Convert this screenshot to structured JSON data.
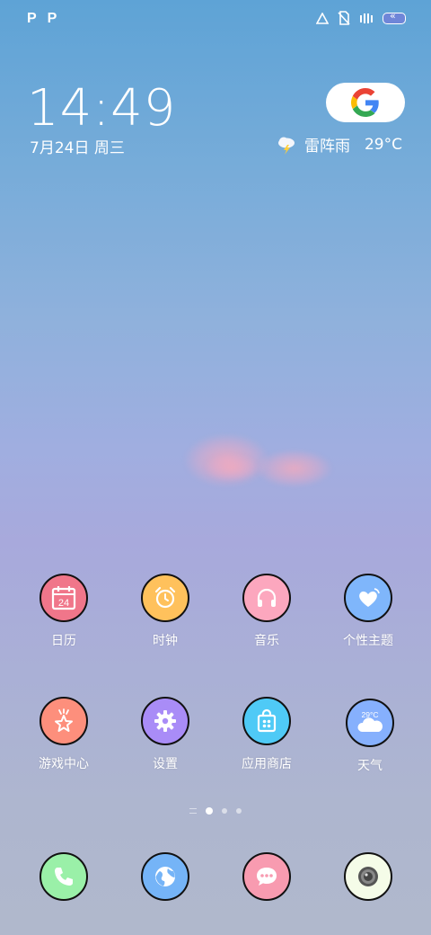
{
  "status_bar": {
    "left_icons": [
      "P",
      "P"
    ],
    "right_icons": [
      "signal-triangle-icon",
      "no-sim-icon",
      "vibrate-icon",
      "battery-icon"
    ]
  },
  "clock": {
    "time": "14:49",
    "date": "7月24日 周三"
  },
  "weather": {
    "condition": "雷阵雨",
    "temperature": "29°C",
    "icon": "thunderstorm-icon"
  },
  "search": {
    "icon": "google-icon"
  },
  "apps_row1": [
    {
      "label": "日历",
      "icon": "calendar-icon",
      "color": "#f0768a",
      "badge": "24"
    },
    {
      "label": "时钟",
      "icon": "alarm-clock-icon",
      "color": "#ffc15c"
    },
    {
      "label": "音乐",
      "icon": "headphones-icon",
      "color": "#fca7be"
    },
    {
      "label": "个性主题",
      "icon": "heart-theme-icon",
      "color": "#7fb6fb"
    }
  ],
  "apps_row2": [
    {
      "label": "游戏中心",
      "icon": "star-game-icon",
      "color": "#fd8f7c"
    },
    {
      "label": "设置",
      "icon": "gear-icon",
      "color": "#a98cf7"
    },
    {
      "label": "应用商店",
      "icon": "shopping-bag-icon",
      "color": "#4fcaf6"
    },
    {
      "label": "天气",
      "icon": "weather-cloud-icon",
      "color": "#86b0fd",
      "badge": "29°C"
    }
  ],
  "dock": [
    {
      "name": "phone",
      "icon": "phone-icon",
      "color": "#9af0a8"
    },
    {
      "name": "browser",
      "icon": "globe-icon",
      "color": "#75b4f7"
    },
    {
      "name": "messages",
      "icon": "message-bubble-icon",
      "color": "#f89bb0"
    },
    {
      "name": "camera",
      "icon": "camera-lens-icon",
      "color": "#f5fce8"
    }
  ],
  "page_indicator": {
    "pages": 4,
    "current": 2
  }
}
